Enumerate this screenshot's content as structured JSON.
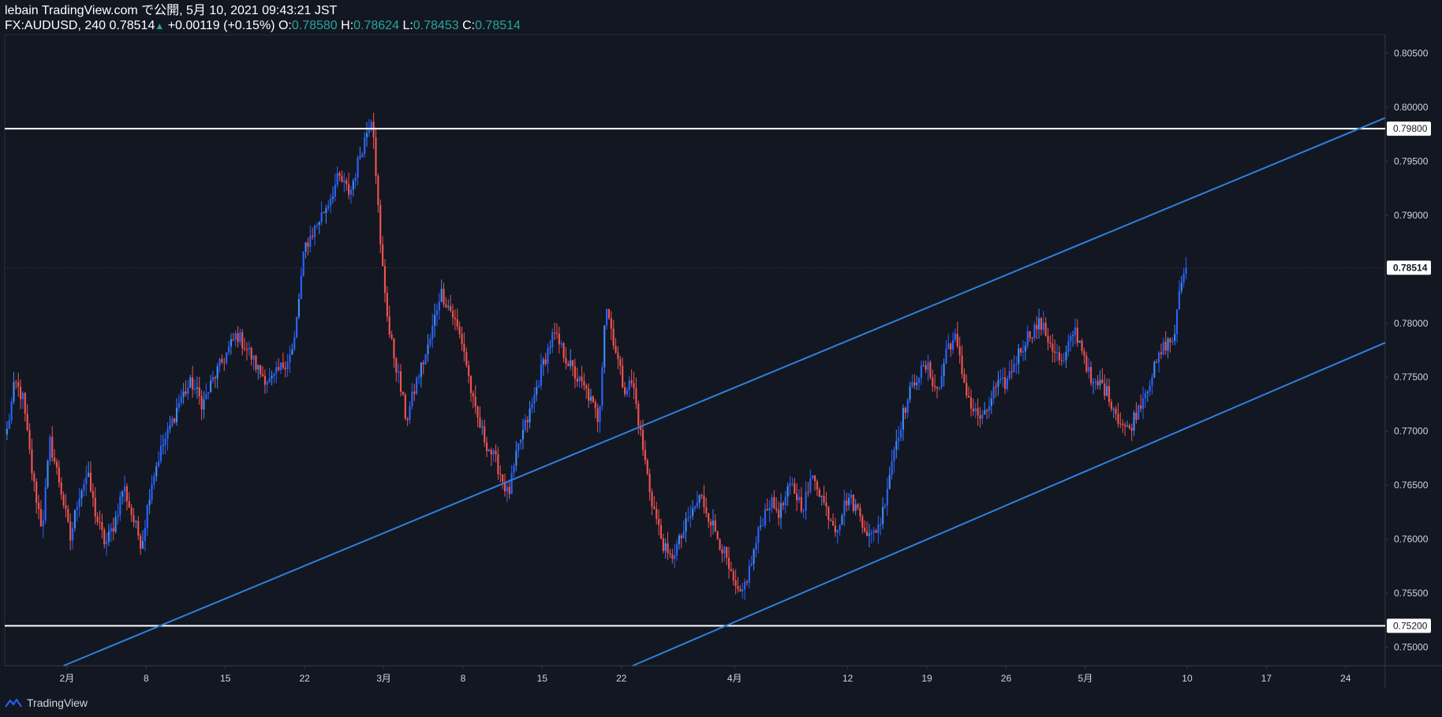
{
  "header": {
    "published": "lebain TradingView.com で公開, 5月 10, 2021 09:43:21 JST",
    "symbol": "FX:AUDUSD, 240",
    "last": "0.78514",
    "change": "+0.00119 (+0.15%)",
    "o_label": "O:",
    "o_value": "0.78580",
    "h_label": "H:",
    "h_value": "0.78624",
    "l_label": "L:",
    "l_value": "0.78453",
    "c_label": "C:",
    "c_value": "0.78514"
  },
  "footer": {
    "brand": "TradingView"
  },
  "colors": {
    "background": "#131722",
    "up_candle": "#2962ff",
    "up_candle_light": "#3d8bfd",
    "down_candle": "#ef5350",
    "trendline": "#2f7fe0",
    "level_line": "#ffffff",
    "text": "#d1d4dc",
    "value_green": "#26a69a"
  },
  "chart_data": {
    "type": "candlestick",
    "symbol": "FX:AUDUSD",
    "interval": "240",
    "y_ticks": [
      "0.80500",
      "0.80000",
      "0.79500",
      "0.79000",
      "0.78000",
      "0.77500",
      "0.77000",
      "0.76500",
      "0.76000",
      "0.75500",
      "0.75000"
    ],
    "y_tick_values": [
      0.805,
      0.8,
      0.795,
      0.79,
      0.78,
      0.775,
      0.77,
      0.765,
      0.76,
      0.755,
      0.75
    ],
    "ylim": [
      0.7483,
      0.8067
    ],
    "x_ticks": [
      "2月",
      "8",
      "15",
      "22",
      "3月",
      "8",
      "15",
      "22",
      "4月",
      "12",
      "19",
      "26",
      "5月",
      "10",
      "17",
      "24"
    ],
    "x_tick_days": [
      0,
      7,
      14,
      21,
      28,
      35,
      42,
      49,
      59,
      69,
      76,
      83,
      90,
      99,
      106,
      113
    ],
    "xlim_days": [
      -5.5,
      116.5
    ],
    "last_price_label": "0.78514",
    "last_price": 0.78514,
    "horizontal_levels": [
      {
        "label": "0.79800",
        "price": 0.798
      },
      {
        "label": "0.75200",
        "price": 0.752
      }
    ],
    "trendlines": [
      {
        "points": [
          [
            -0.3,
            0.7483
          ],
          [
            116.5,
            0.799
          ]
        ]
      },
      {
        "points": [
          [
            50,
            0.7483
          ],
          [
            116.5,
            0.7782
          ]
        ]
      }
    ],
    "price_path": [
      [
        -5.3,
        0.77
      ],
      [
        -4.6,
        0.7745
      ],
      [
        -3.9,
        0.773
      ],
      [
        -3.0,
        0.7655
      ],
      [
        -2.2,
        0.761
      ],
      [
        -1.5,
        0.769
      ],
      [
        -0.6,
        0.765
      ],
      [
        0.3,
        0.76
      ],
      [
        1.0,
        0.764
      ],
      [
        1.8,
        0.766
      ],
      [
        2.6,
        0.762
      ],
      [
        3.4,
        0.7595
      ],
      [
        4.2,
        0.7615
      ],
      [
        5.0,
        0.765
      ],
      [
        5.8,
        0.762
      ],
      [
        6.6,
        0.7595
      ],
      [
        7.4,
        0.765
      ],
      [
        8.2,
        0.768
      ],
      [
        9.0,
        0.77
      ],
      [
        10.0,
        0.773
      ],
      [
        11.0,
        0.7745
      ],
      [
        12.0,
        0.7725
      ],
      [
        13.0,
        0.775
      ],
      [
        14.0,
        0.777
      ],
      [
        15.0,
        0.779
      ],
      [
        16.0,
        0.7775
      ],
      [
        17.0,
        0.7755
      ],
      [
        18.0,
        0.7745
      ],
      [
        19.0,
        0.776
      ],
      [
        20.0,
        0.7775
      ],
      [
        21.0,
        0.787
      ],
      [
        22.0,
        0.789
      ],
      [
        23.0,
        0.791
      ],
      [
        24.0,
        0.7935
      ],
      [
        25.0,
        0.792
      ],
      [
        26.0,
        0.796
      ],
      [
        27.0,
        0.7995
      ],
      [
        27.7,
        0.787
      ],
      [
        28.5,
        0.779
      ],
      [
        29.3,
        0.775
      ],
      [
        30.0,
        0.771
      ],
      [
        31.0,
        0.775
      ],
      [
        32.0,
        0.778
      ],
      [
        33.0,
        0.783
      ],
      [
        34.0,
        0.781
      ],
      [
        35.0,
        0.778
      ],
      [
        36.0,
        0.772
      ],
      [
        37.0,
        0.769
      ],
      [
        38.0,
        0.767
      ],
      [
        39.0,
        0.764
      ],
      [
        40.0,
        0.769
      ],
      [
        41.0,
        0.772
      ],
      [
        42.0,
        0.776
      ],
      [
        43.0,
        0.779
      ],
      [
        44.0,
        0.777
      ],
      [
        45.0,
        0.775
      ],
      [
        46.0,
        0.7735
      ],
      [
        47.0,
        0.771
      ],
      [
        47.6,
        0.782
      ],
      [
        48.4,
        0.778
      ],
      [
        49.2,
        0.774
      ],
      [
        50.0,
        0.7745
      ],
      [
        50.8,
        0.769
      ],
      [
        51.6,
        0.764
      ],
      [
        52.4,
        0.7605
      ],
      [
        53.2,
        0.758
      ],
      [
        54.0,
        0.7595
      ],
      [
        55.0,
        0.762
      ],
      [
        56.0,
        0.764
      ],
      [
        57.0,
        0.7615
      ],
      [
        58.0,
        0.759
      ],
      [
        58.8,
        0.756
      ],
      [
        59.5,
        0.7545
      ],
      [
        60.4,
        0.7575
      ],
      [
        61.2,
        0.761
      ],
      [
        62.0,
        0.7635
      ],
      [
        63.0,
        0.7625
      ],
      [
        64.0,
        0.765
      ],
      [
        65.0,
        0.763
      ],
      [
        66.0,
        0.766
      ],
      [
        67.0,
        0.763
      ],
      [
        68.0,
        0.761
      ],
      [
        69.0,
        0.764
      ],
      [
        70.0,
        0.7625
      ],
      [
        71.0,
        0.76
      ],
      [
        72.0,
        0.762
      ],
      [
        73.0,
        0.768
      ],
      [
        74.0,
        0.772
      ],
      [
        75.0,
        0.775
      ],
      [
        76.0,
        0.776
      ],
      [
        77.0,
        0.7735
      ],
      [
        77.8,
        0.778
      ],
      [
        78.5,
        0.7785
      ],
      [
        79.3,
        0.7745
      ],
      [
        80.0,
        0.772
      ],
      [
        81.0,
        0.771
      ],
      [
        82.0,
        0.774
      ],
      [
        83.0,
        0.7745
      ],
      [
        84.0,
        0.777
      ],
      [
        85.0,
        0.779
      ],
      [
        86.0,
        0.78
      ],
      [
        87.0,
        0.778
      ],
      [
        88.0,
        0.776
      ],
      [
        89.0,
        0.7795
      ],
      [
        89.8,
        0.7775
      ],
      [
        90.6,
        0.774
      ],
      [
        91.4,
        0.7745
      ],
      [
        92.2,
        0.773
      ],
      [
        93.0,
        0.771
      ],
      [
        93.8,
        0.77
      ],
      [
        94.6,
        0.772
      ],
      [
        95.4,
        0.774
      ],
      [
        96.2,
        0.776
      ],
      [
        97.0,
        0.778
      ],
      [
        97.8,
        0.7785
      ],
      [
        98.5,
        0.784
      ],
      [
        99.0,
        0.7851
      ]
    ]
  }
}
